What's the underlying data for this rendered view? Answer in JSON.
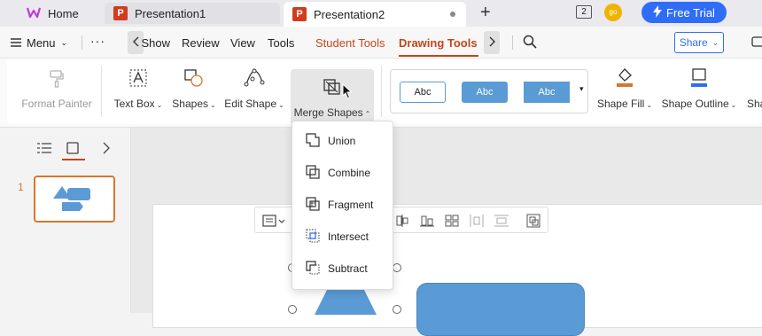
{
  "titlebar": {
    "tabs": [
      {
        "label": "Home"
      },
      {
        "label": "Presentation1"
      },
      {
        "label": "Presentation2"
      }
    ],
    "add_tab": "+",
    "page_indicator": "2",
    "free_trial": "Free Trial",
    "avatar_initials": "go"
  },
  "menubar": {
    "menu_label": "Menu",
    "more": "···",
    "items": [
      "Show",
      "Review",
      "View",
      "Tools",
      "Student Tools",
      "Drawing Tools"
    ],
    "share": "Share"
  },
  "ribbon": {
    "format_painter": "Format Painter",
    "text_box": "Text Box",
    "shapes": "Shapes",
    "edit_shape": "Edit Shape",
    "merge_shapes": "Merge Shapes",
    "style_samples": [
      "Abc",
      "Abc",
      "Abc"
    ],
    "shape_fill": "Shape Fill",
    "shape_outline": "Shape Outline",
    "shape_effects_partial": "Sha"
  },
  "leftpane": {
    "slide_number": "1"
  },
  "merge_menu": {
    "items": [
      "Union",
      "Combine",
      "Fragment",
      "Intersect",
      "Subtract"
    ]
  },
  "colors": {
    "accent_orange": "#c0471b",
    "brand_blue": "#2f6df6",
    "shape_blue": "#5b9bd5",
    "selected_border": "#d9762b"
  }
}
